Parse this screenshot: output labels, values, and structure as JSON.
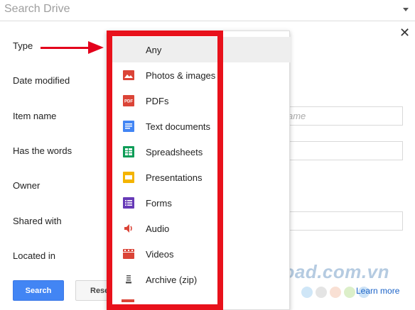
{
  "search": {
    "placeholder": "Search Drive"
  },
  "form": {
    "labels": {
      "type": "Type",
      "date_modified": "Date modified",
      "item_name": "Item name",
      "has_words": "Has the words",
      "owner": "Owner",
      "shared_with": "Shared with",
      "located_in": "Located in"
    },
    "item_name_placeholder": "ame"
  },
  "buttons": {
    "search": "Search",
    "reset": "Rese",
    "learn_more": "Learn more"
  },
  "dropdown": {
    "items": [
      {
        "label": "Any",
        "icon": "none",
        "selected": true
      },
      {
        "label": "Photos & images",
        "icon": "image-icon",
        "color": "#db4437"
      },
      {
        "label": "PDFs",
        "icon": "pdf-icon",
        "color": "#db4437"
      },
      {
        "label": "Text documents",
        "icon": "document-icon",
        "color": "#4285f4"
      },
      {
        "label": "Spreadsheets",
        "icon": "spreadsheet-icon",
        "color": "#0f9d58"
      },
      {
        "label": "Presentations",
        "icon": "presentation-icon",
        "color": "#f4b400"
      },
      {
        "label": "Forms",
        "icon": "form-icon",
        "color": "#673ab7"
      },
      {
        "label": "Audio",
        "icon": "audio-icon",
        "color": "#db4437"
      },
      {
        "label": "Videos",
        "icon": "video-icon",
        "color": "#db4437"
      },
      {
        "label": "Archive (zip)",
        "icon": "archive-icon",
        "color": "#555555"
      }
    ],
    "pdf_icon_text": "PDF"
  },
  "watermark": {
    "text": "Download.com.vn"
  },
  "colors": {
    "highlight": "#e8111b",
    "accent": "#4285f4"
  }
}
